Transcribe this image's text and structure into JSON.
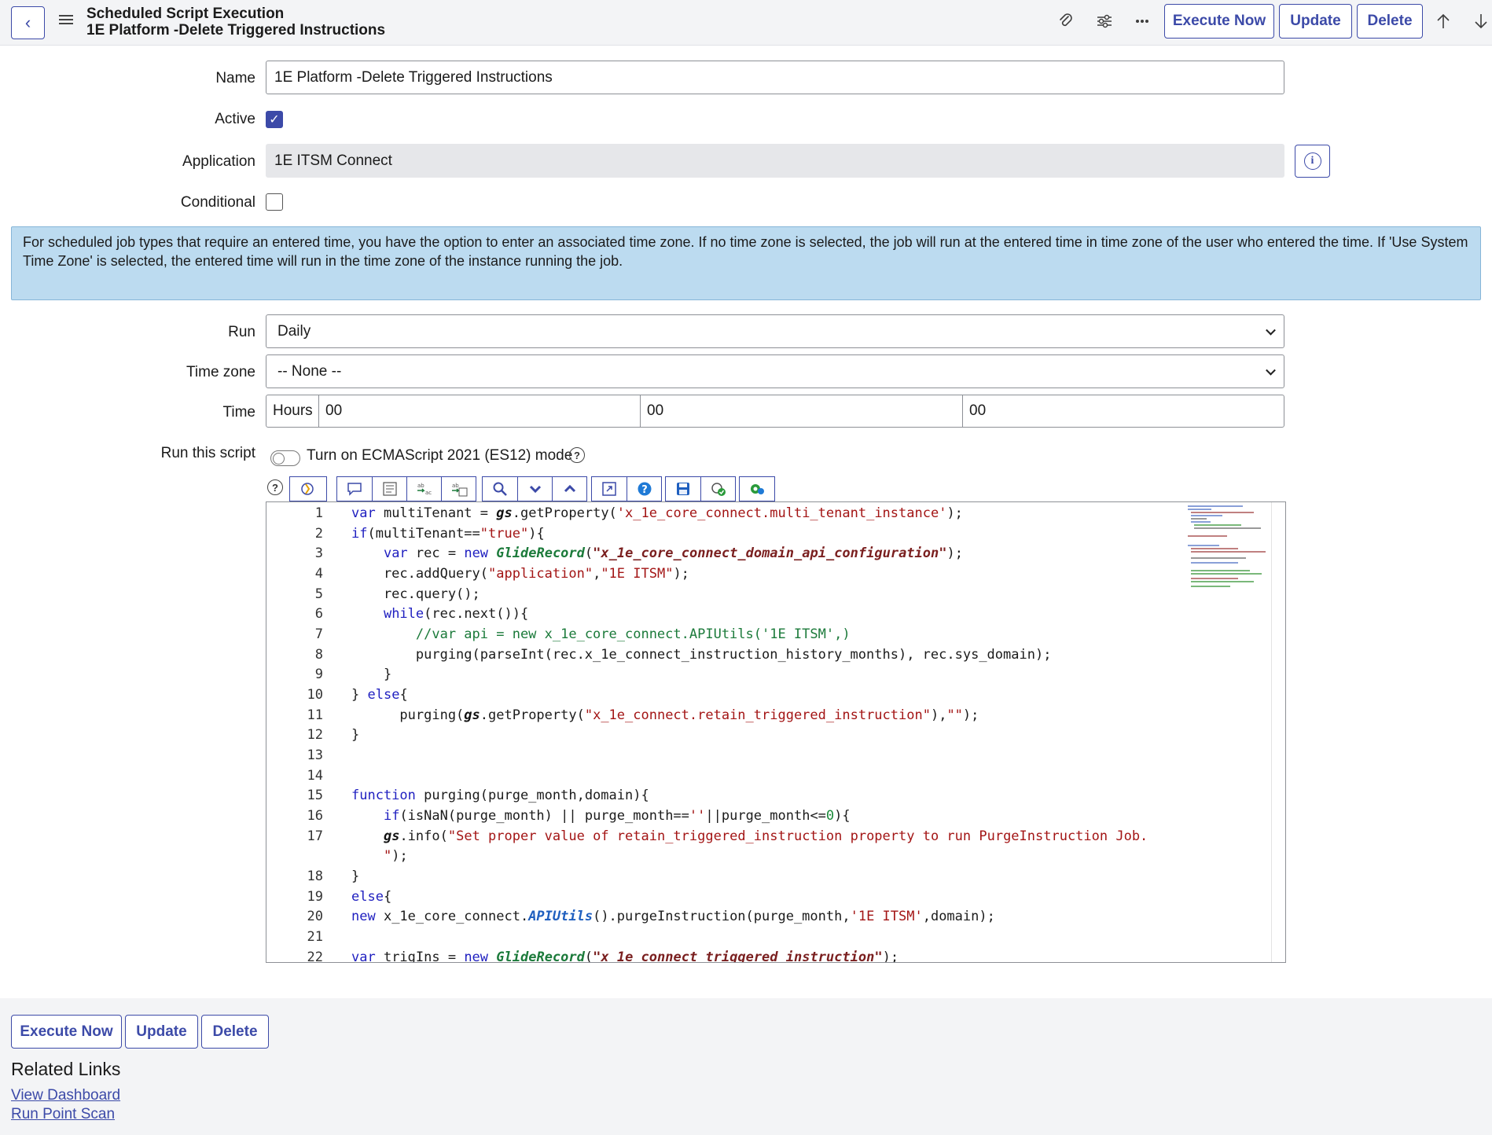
{
  "header": {
    "record_type": "Scheduled Script Execution",
    "record_name": "1E Platform -Delete Triggered Instructions",
    "execute_label": "Execute Now",
    "update_label": "Update",
    "delete_label": "Delete",
    "icons": [
      "back-icon",
      "menu-icon",
      "paperclip-icon",
      "settings-sliders-icon",
      "more-icon",
      "arrow-up-icon",
      "arrow-down-icon"
    ]
  },
  "form": {
    "name_label": "Name",
    "name_value": "1E Platform -Delete Triggered Instructions",
    "active_label": "Active",
    "active_checked": true,
    "application_label": "Application",
    "application_value": "1E ITSM Connect",
    "conditional_label": "Conditional",
    "conditional_checked": false,
    "info_message": "For scheduled job types that require an entered time, you have the option to enter an associated time zone. If no time zone is selected, the job will run at the entered time in time zone of the user who entered the time. If 'Use System Time Zone' is selected, the entered time will run in the time zone of the instance running the job.",
    "run_label": "Run",
    "run_value": "Daily",
    "timezone_label": "Time zone",
    "timezone_value": "-- None --",
    "time_label": "Time",
    "hours_label": "Hours",
    "time_hours": "00",
    "time_minutes": "00",
    "time_seconds": "00",
    "script_label": "Run this script",
    "es12_label": "Turn on ECMAScript 2021 (ES12) mode",
    "es12_on": false
  },
  "editor": {
    "toolbar_icons": [
      "help-icon",
      "syntax-checking-icon",
      "comment-icon",
      "format-code-icon",
      "replace-icon",
      "replace-all-icon",
      "search-icon",
      "expand-icon",
      "collapse-icon",
      "fullscreen-icon",
      "script-help-icon",
      "save-icon",
      "script-debug-icon",
      "toggle-syntax-icon"
    ],
    "line_numbers": [
      "1",
      "2",
      "3",
      "4",
      "5",
      "6",
      "7",
      "8",
      "9",
      "10",
      "11",
      "12",
      "13",
      "14",
      "15",
      "16",
      "17",
      "",
      "18",
      "19",
      "20",
      "21",
      "22"
    ]
  },
  "footer": {
    "execute_label": "Execute Now",
    "update_label": "Update",
    "delete_label": "Delete",
    "related_links_title": "Related Links",
    "links": [
      "View Dashboard",
      "Run Point Scan"
    ]
  },
  "colors": {
    "accent": "#3c4aa8",
    "info_bg": "#bcdbf0",
    "header_bg": "#f3f4f6",
    "keyword": "#1f1fc0",
    "string": "#a31515"
  }
}
